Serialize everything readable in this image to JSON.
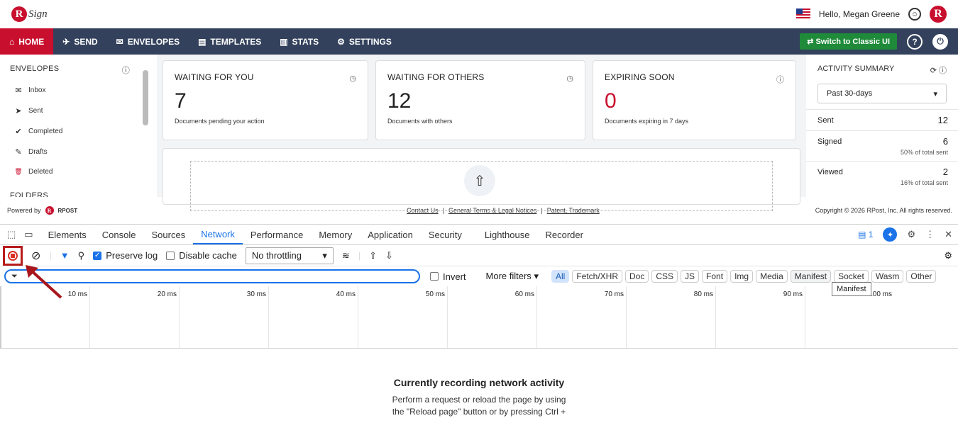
{
  "header": {
    "logo_text": "Sign",
    "logo_letter": "R",
    "greeting": "Hello, Megan Greene",
    "brand_letter": "R"
  },
  "nav": {
    "items": [
      {
        "label": "HOME",
        "icon": "⌂"
      },
      {
        "label": "SEND",
        "icon": "✈"
      },
      {
        "label": "ENVELOPES",
        "icon": "✉"
      },
      {
        "label": "TEMPLATES",
        "icon": "▤"
      },
      {
        "label": "STATS",
        "icon": "▥"
      },
      {
        "label": "SETTINGS",
        "icon": "⚙"
      }
    ],
    "classic_label": "Switch to Classic UI",
    "help": "?",
    "power": "⏻"
  },
  "sidebar": {
    "title": "ENVELOPES",
    "items": [
      {
        "label": "Inbox",
        "icon": "✉"
      },
      {
        "label": "Sent",
        "icon": "➤"
      },
      {
        "label": "Completed",
        "icon": "✔"
      },
      {
        "label": "Drafts",
        "icon": "✎"
      },
      {
        "label": "Deleted",
        "icon": "🗑"
      }
    ],
    "folders": "FOLDERS"
  },
  "cards": [
    {
      "title": "WAITING FOR YOU",
      "value": "7",
      "sub": "Documents pending your action"
    },
    {
      "title": "WAITING FOR OTHERS",
      "value": "12",
      "sub": "Documents with others"
    },
    {
      "title": "EXPIRING SOON",
      "value": "0",
      "sub": "Documents expiring in 7 days"
    }
  ],
  "activity": {
    "title": "ACTIVITY SUMMARY",
    "period": "Past 30-days",
    "rows": [
      {
        "label": "Sent",
        "value": "12",
        "pct": ""
      },
      {
        "label": "Signed",
        "value": "6",
        "pct": "50% of total sent"
      },
      {
        "label": "Viewed",
        "value": "2",
        "pct": "16% of total sent"
      }
    ]
  },
  "footer": {
    "powered": "Powered by",
    "brand": "RPOST",
    "links": [
      "Contact Us",
      "General Terms & Legal Notices",
      "Patent, Trademark"
    ],
    "copyright": "Copyright © 2026 RPost, Inc. All rights reserved."
  },
  "devtools": {
    "tabs": [
      "Elements",
      "Console",
      "Sources",
      "Network",
      "Performance",
      "Memory",
      "Application",
      "Security",
      "Lighthouse",
      "Recorder"
    ],
    "issues_count": "1",
    "preserve_log": "Preserve log",
    "disable_cache": "Disable cache",
    "throttling": "No throttling",
    "invert": "Invert",
    "more_filters": "More filters",
    "filter_types": [
      "All",
      "Fetch/XHR",
      "Doc",
      "CSS",
      "JS",
      "Font",
      "Img",
      "Media",
      "Manifest",
      "Socket",
      "Wasm",
      "Other"
    ],
    "ticks": [
      "10 ms",
      "20 ms",
      "30 ms",
      "40 ms",
      "50 ms",
      "60 ms",
      "70 ms",
      "80 ms",
      "90 ms",
      "100 ms"
    ],
    "tooltip": "Manifest",
    "empty_title": "Currently recording network activity",
    "empty_line1": "Perform a request or reload the page by using",
    "empty_line2": "the \"Reload page\" button or by pressing Ctrl +"
  }
}
